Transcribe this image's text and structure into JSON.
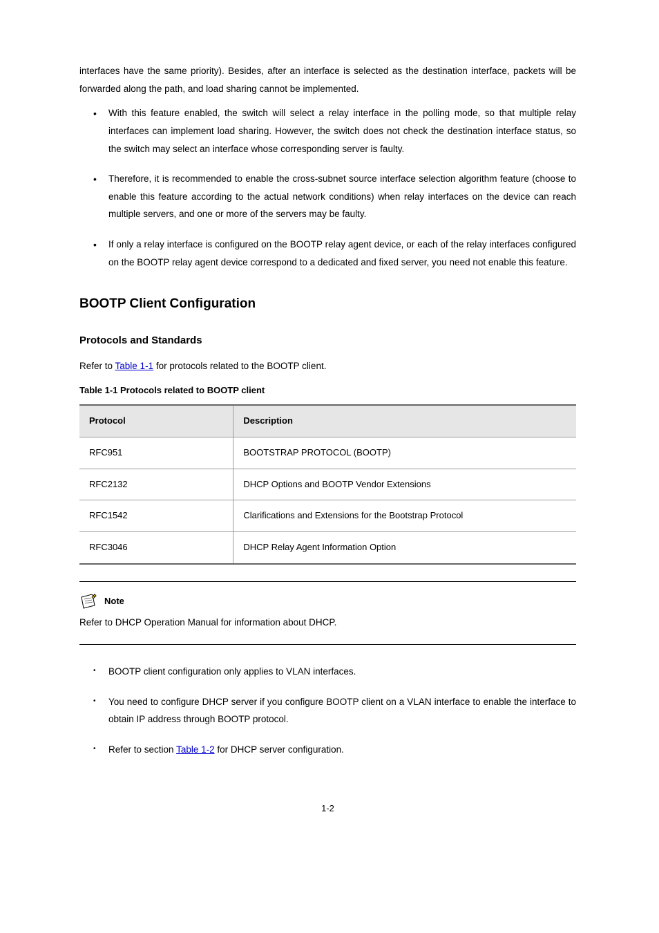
{
  "para_intro": "interfaces have the same priority). Besides, after an interface is selected as the destination interface, packets will be forwarded along the path, and load sharing cannot be implemented.",
  "bullets_top": [
    "With this feature enabled, the switch will select a relay interface in the polling mode, so that multiple relay interfaces can implement load sharing. However, the switch does not check the destination interface status, so the switch may select an interface whose corresponding server is faulty.",
    "Therefore, it is recommended to enable the cross-subnet source interface selection algorithm feature (choose to enable this feature according to the actual network conditions) when relay interfaces on the device can reach multiple servers, and one or more of the servers may be faulty.",
    "If only a relay interface is configured on the BOOTP relay agent device, or each of the relay interfaces configured on the BOOTP relay agent device correspond to a dedicated and fixed server, you need not enable this feature."
  ],
  "h1": "BOOTP Client Configuration",
  "h2": "Protocols and Standards",
  "proto_intro_prefix": "Refer to ",
  "proto_link": "Table 1-1",
  "proto_intro_suffix": " for protocols related to the BOOTP client.",
  "table_caption": "Table 1-1 Protocols related to BOOTP client",
  "table_headers": [
    "Protocol",
    "Description"
  ],
  "table_rows": [
    [
      "RFC951",
      "BOOTSTRAP PROTOCOL (BOOTP)"
    ],
    [
      "RFC2132",
      "DHCP Options and BOOTP Vendor Extensions"
    ],
    [
      "RFC1542",
      "Clarifications and Extensions for the Bootstrap Protocol"
    ],
    [
      "RFC3046",
      "DHCP Relay Agent Information Option"
    ]
  ],
  "note_label": "Note",
  "note_text": "Refer to DHCP Operation Manual for information about DHCP.",
  "bullets_bottom_plain": [
    "BOOTP client configuration only applies to VLAN interfaces.",
    "You need to configure DHCP server if you configure BOOTP client on a VLAN interface to enable the interface to obtain IP address through BOOTP protocol.",
    {
      "prefix": "Refer to section ",
      "link": "Table 1-2",
      "suffix": " for DHCP server configuration."
    }
  ],
  "footer": "1-2"
}
